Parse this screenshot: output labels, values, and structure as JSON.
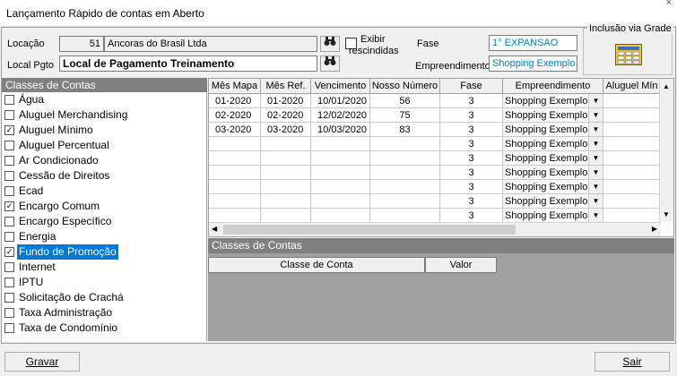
{
  "window": {
    "title": "Lançamento Rápido de contas em Aberto",
    "close": "×"
  },
  "form": {
    "locacao_label": "Locação",
    "locacao_code": "51",
    "locacao_name": "Ancoras do Brasil Ltda",
    "local_pgto_label": "Local Pgto",
    "local_pgto_value": "Local de Pagamento Treinamento",
    "exibir_label_1": "Exibir",
    "exibir_label_2": "rescindidas",
    "fase_label": "Fase",
    "fase_value": "1° EXPANSAO",
    "empreendimento_label": "Empreendimento",
    "empreendimento_value": "Shopping Exemplo",
    "inclusao_label": "Inclusão via Grade"
  },
  "classes": {
    "header": "Classes de Contas",
    "items": [
      {
        "label": "Água",
        "checked": false
      },
      {
        "label": "Aluguel Merchandising",
        "checked": false
      },
      {
        "label": "Aluguel Mínimo",
        "checked": true
      },
      {
        "label": "Aluguel Percentual",
        "checked": false
      },
      {
        "label": "Ar Condicionado",
        "checked": false
      },
      {
        "label": "Cessão de Direitos",
        "checked": false
      },
      {
        "label": "Ecad",
        "checked": false
      },
      {
        "label": "Encargo Comum",
        "checked": true
      },
      {
        "label": "Encargo Específico",
        "checked": false
      },
      {
        "label": "Energia",
        "checked": false
      },
      {
        "label": "Fundo de Promoção",
        "checked": true,
        "selected": true
      },
      {
        "label": "Internet",
        "checked": false
      },
      {
        "label": "IPTU",
        "checked": false
      },
      {
        "label": "Solicitação de Crachá",
        "checked": false
      },
      {
        "label": "Taxa Administração",
        "checked": false
      },
      {
        "label": "Taxa de Condomínio",
        "checked": false
      }
    ]
  },
  "grid": {
    "columns": [
      "Mês Mapa",
      "Mês Ref.",
      "Vencimento",
      "Nosso Número",
      "Fase",
      "Empreendimento",
      "Aluguel Mín"
    ],
    "rows": [
      [
        "01-2020",
        "01-2020",
        "10/01/2020",
        "56",
        "3",
        "Shopping Exemplo"
      ],
      [
        "02-2020",
        "02-2020",
        "12/02/2020",
        "75",
        "3",
        "Shopping Exemplo"
      ],
      [
        "03-2020",
        "03-2020",
        "10/03/2020",
        "83",
        "3",
        "Shopping Exemplo"
      ],
      [
        "",
        "",
        "",
        "",
        "3",
        "Shopping Exemplo"
      ],
      [
        "",
        "",
        "",
        "",
        "3",
        "Shopping Exemplo"
      ],
      [
        "",
        "",
        "",
        "",
        "3",
        "Shopping Exemplo"
      ],
      [
        "",
        "",
        "",
        "",
        "3",
        "Shopping Exemplo"
      ],
      [
        "",
        "",
        "",
        "",
        "3",
        "Shopping Exemplo"
      ],
      [
        "",
        "",
        "",
        "",
        "3",
        "Shopping Exemplo"
      ]
    ]
  },
  "sub": {
    "header": "Classes de Contas",
    "col1": "Classe de Conta",
    "col2": "Valor"
  },
  "buttons": {
    "gravar": "Gravar",
    "sair": "Sair"
  }
}
